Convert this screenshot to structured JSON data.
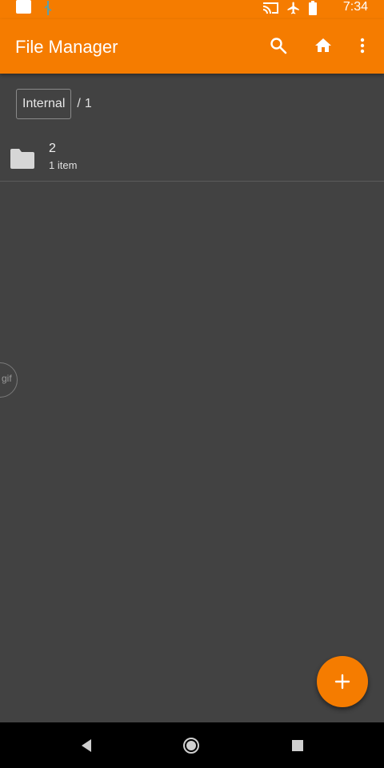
{
  "status_bar": {
    "time": "7:34",
    "icons": [
      "notification-square-icon",
      "usb-icon",
      "cast-icon",
      "airplane-mode-icon",
      "battery-icon"
    ]
  },
  "app_bar": {
    "title": "File Manager",
    "actions": [
      "search-icon",
      "home-icon",
      "more-vert-icon"
    ]
  },
  "breadcrumb": {
    "root": "Internal",
    "separator": "/",
    "current": "1"
  },
  "files": [
    {
      "name": "2",
      "meta": "1 item",
      "icon": "folder-icon"
    }
  ],
  "edge_handle": {
    "label": "gif"
  },
  "fab": {
    "icon": "plus-icon"
  },
  "nav_bar": {
    "buttons": [
      "back-icon",
      "home-circle-icon",
      "recents-icon"
    ]
  },
  "colors": {
    "accent": "#f57c00",
    "background": "#424242",
    "nav": "#000000"
  }
}
